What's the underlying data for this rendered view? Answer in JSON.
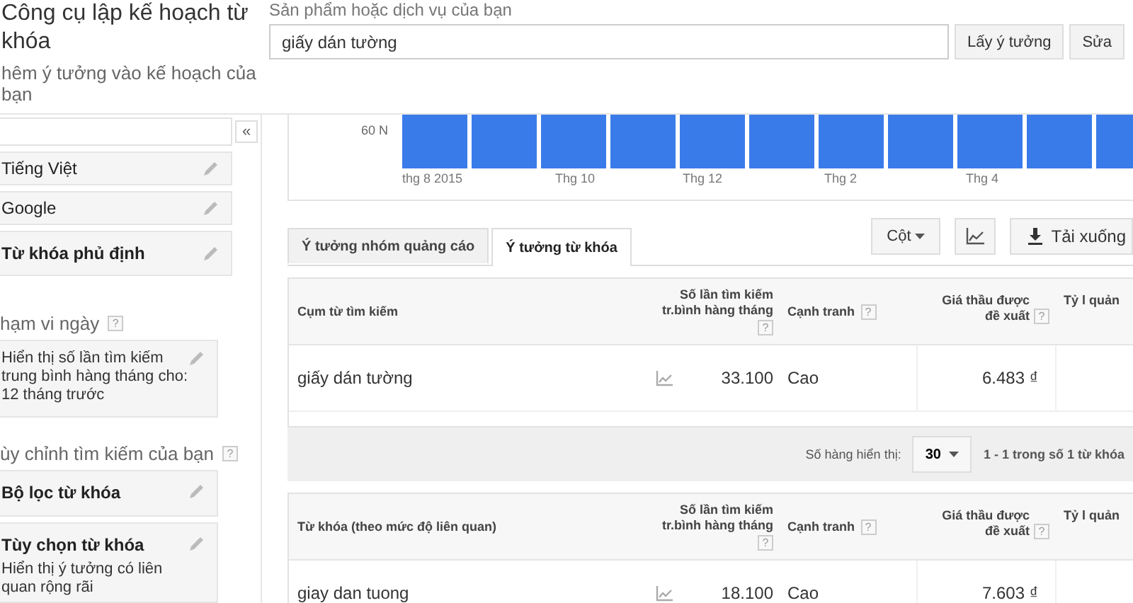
{
  "header": {
    "title": "Công cụ lập kế hoạch từ khóa",
    "subtitle": "hêm ý tưởng vào kế hoạch của bạn"
  },
  "search": {
    "label": "Sản phẩm hoặc dịch vụ của bạn",
    "value": "giấy dán tường",
    "buttons": [
      "Lấy ý tưởng",
      "Sửa"
    ]
  },
  "sidebar": {
    "collapse": "«",
    "targeting": [
      {
        "label": "Tiếng Việt",
        "kind": "value"
      },
      {
        "label": "Google",
        "kind": "value"
      },
      {
        "label": "Từ khóa phủ định",
        "kind": "heading"
      }
    ],
    "date_range": {
      "heading": "hạm vi ngày",
      "help": "?",
      "text": "Hiển thị số lần tìm kiếm trung bình hàng tháng cho: 12 tháng trước"
    },
    "customize": {
      "heading": "ùy chỉnh tìm kiếm của bạn",
      "help": "?",
      "items": [
        {
          "title": "Bộ lọc từ khóa"
        },
        {
          "title": "Tùy chọn từ khóa",
          "description": "Hiển thị ý tưởng có liên quan rộng rãi"
        }
      ]
    }
  },
  "chart": {
    "y_label": "60 N",
    "x_labels": [
      "thg 8 2015",
      "Thg 10",
      "Thg 12",
      "Thg 2",
      "Thg 4"
    ]
  },
  "tabs": [
    {
      "label": "Ý tưởng nhóm quảng cáo",
      "selected": false
    },
    {
      "label": "Ý tưởng từ khóa",
      "selected": true
    }
  ],
  "toolbar": {
    "columns_button": "Cột",
    "download_button": "Tải xuống"
  },
  "tables": [
    {
      "columns": [
        {
          "label": "Cụm từ tìm kiếm"
        },
        {
          "label": "Số lần tìm kiếm tr.bình hàng tháng",
          "help": "?"
        },
        {
          "label": "Cạnh tranh",
          "help": "?"
        },
        {
          "label": "Giá thầu được đề xuất",
          "help": "?"
        },
        {
          "label": "Tỷ l quản"
        }
      ],
      "rows": [
        {
          "cells": [
            "giấy dán tường",
            "33.100",
            "Cao",
            "6.483 ₫"
          ]
        }
      ]
    },
    {
      "columns": [
        {
          "label": "Từ khóa (theo mức độ liên quan)"
        },
        {
          "label": "Số lần tìm kiếm tr.bình hàng tháng",
          "help": "?"
        },
        {
          "label": "Cạnh tranh",
          "help": "?"
        },
        {
          "label": "Giá thầu được đề xuất",
          "help": "?"
        },
        {
          "label": "Tỷ l quản"
        }
      ],
      "rows": [
        {
          "cells": [
            "giay dan tuong",
            "18.100",
            "Cao",
            "7.603 ₫"
          ]
        }
      ]
    }
  ],
  "pagination": {
    "label": "Số hàng hiển thị:",
    "rows_per_page": "30",
    "range": "1 - 1 trong số 1 từ khóa"
  }
}
